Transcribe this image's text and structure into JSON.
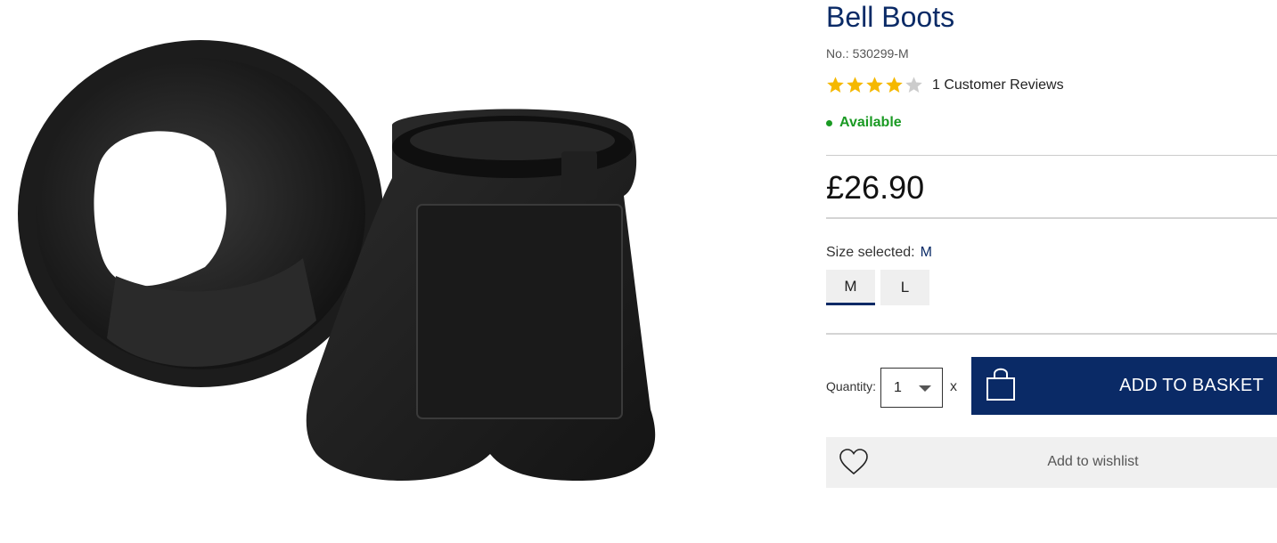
{
  "product": {
    "title": "Bell Boots",
    "article_no": "No.: 530299-M",
    "rating": 4,
    "rating_max": 5,
    "reviews_text": "1 Customer Reviews",
    "availability": "Available",
    "price": "£26.90"
  },
  "size": {
    "label": "Size selected:",
    "selected": "M",
    "options": [
      "M",
      "L"
    ]
  },
  "quantity": {
    "label": "Quantity:",
    "value": "1",
    "times": "x"
  },
  "actions": {
    "add_to_basket": "ADD TO BASKET",
    "add_to_wishlist": "Add to wishlist"
  },
  "icons": {
    "basket": "shopping-bag-icon",
    "wishlist": "heart-icon",
    "dropdown": "chevron-down-icon"
  },
  "colors": {
    "brand_navy": "#0a2a66",
    "available_green": "#1a9a23",
    "star_filled": "#f5b800",
    "star_empty": "#cccccc"
  }
}
